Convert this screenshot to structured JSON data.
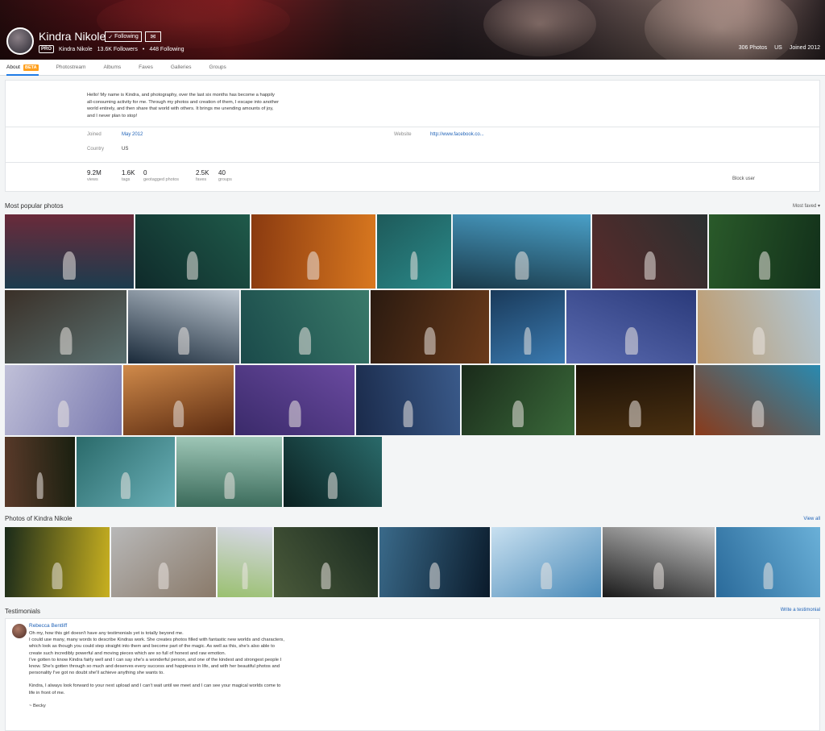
{
  "profile": {
    "name": "Kindra Nikole",
    "following_label": "Following",
    "pro_badge": "PRO",
    "username": "Kindra Nikole",
    "followers": "13.6K Followers",
    "separator": "•",
    "following_count": "448 Following",
    "photos_count": "306 Photos",
    "country": "US",
    "joined": "Joined 2012"
  },
  "tabs": [
    {
      "label": "About",
      "badge": "BETA",
      "active": true
    },
    {
      "label": "Photostream"
    },
    {
      "label": "Albums"
    },
    {
      "label": "Faves"
    },
    {
      "label": "Galleries"
    },
    {
      "label": "Groups"
    }
  ],
  "about": {
    "bio": "Hello! My name is Kindra, and photography, over the last six months has become a happily all-consuming activity for me. Through my photos and creation of them, I escape into another world entirely, and then share that world with others. It brings me unending amounts of joy, and I never plan to stop!",
    "joined_label": "Joined",
    "joined_value": "May 2012",
    "website_label": "Website",
    "website_value": "http://www.facebook.co...",
    "country_label": "Country",
    "country_value": "US",
    "stats": [
      {
        "value": "9.2M",
        "label": "views"
      },
      {
        "value": "1.6K",
        "label": "tags"
      },
      {
        "value": "0",
        "label": "geotagged photos"
      },
      {
        "value": "2.5K",
        "label": "faves"
      },
      {
        "value": "40",
        "label": "groups"
      }
    ],
    "block_user": "Block user"
  },
  "popular": {
    "title": "Most popular photos",
    "sort_label": "Most faved",
    "sort_caret": "▾"
  },
  "photos_of": {
    "title": "Photos of Kindra Nikole",
    "view_all": "View all"
  },
  "testimonials": {
    "title": "Testimonials",
    "write": "Write a testimonial",
    "author": "Rebecca Bentliff",
    "paragraphs": [
      "Oh my, how this girl doesn't have any testimonials yet is totally beyond me.\nI could use many, many words to describe Kindras work. She creates photos filled with fantastic new worlds and characters, which look as though you could step straight into them and become part of the magic. As well as this, she's also able to create such incredibly powerful and moving pieces which are so full of honest and raw emotion.\nI've gotten to know Kindra fairly well and I can say she's a wonderful person, and one of the kindest and strongest people I know. She's gotten through so much and deserves every success and happiness in life, and with her beautiful photos and personality I've got no doubt she'll achieve anything she wants to.",
      "Kindra, I always look forward to your next upload and I can't wait until we meet and I can see your magical worlds come to life in front of me.",
      "~ Becky"
    ]
  }
}
